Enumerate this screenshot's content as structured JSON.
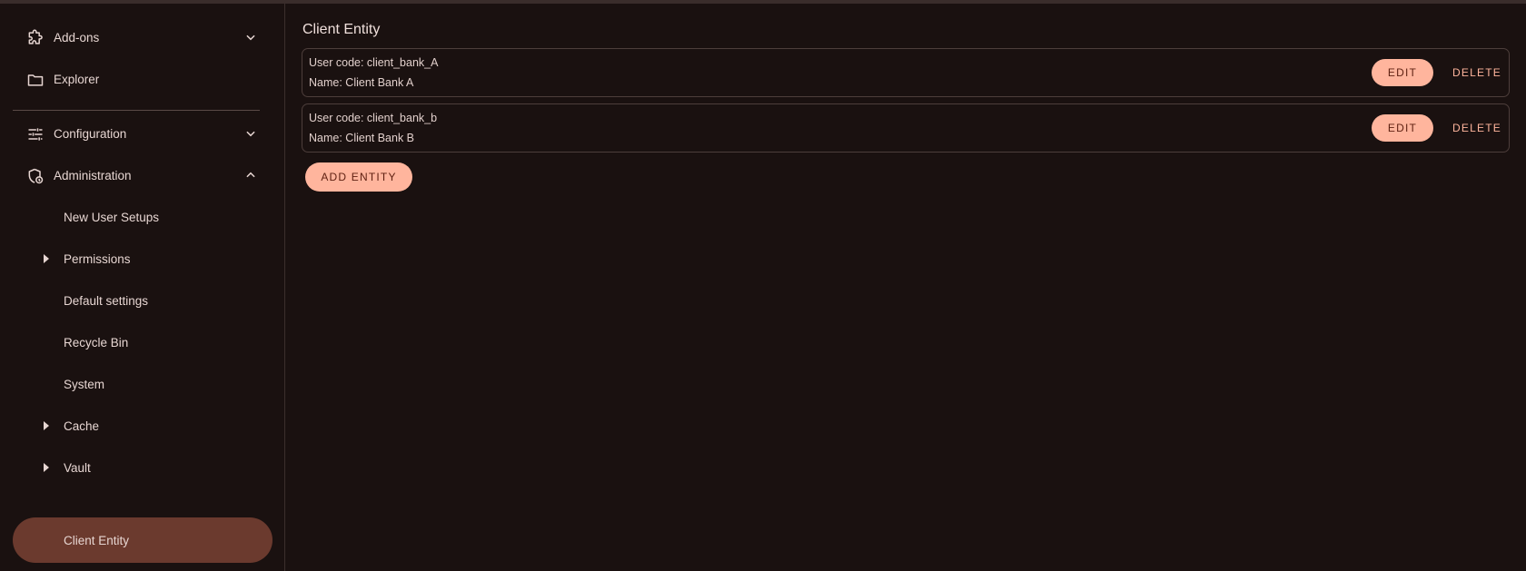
{
  "sidebar": {
    "items": [
      {
        "label": "Add-ons",
        "icon": "puzzle-icon",
        "chevron": "down"
      },
      {
        "label": "Explorer",
        "icon": "folder-icon"
      },
      {
        "label": "Configuration",
        "icon": "tune-icon",
        "chevron": "down"
      },
      {
        "label": "Administration",
        "icon": "admin-shield-icon",
        "chevron": "up"
      }
    ],
    "admin_children": [
      {
        "label": "New User Setups",
        "expandable": false
      },
      {
        "label": "Permissions",
        "expandable": true
      },
      {
        "label": "Default settings",
        "expandable": false
      },
      {
        "label": "Recycle Bin",
        "expandable": false
      },
      {
        "label": "System",
        "expandable": false
      },
      {
        "label": "Cache",
        "expandable": true
      },
      {
        "label": "Vault",
        "expandable": true
      },
      {
        "label": "Client Entity",
        "expandable": false,
        "active": true
      }
    ]
  },
  "main": {
    "title": "Client Entity",
    "entities": [
      {
        "code_line": "User code: client_bank_A",
        "name_line": "Name: Client Bank A"
      },
      {
        "code_line": "User code: client_bank_b",
        "name_line": "Name: Client Bank B"
      }
    ],
    "edit_label": "EDIT",
    "delete_label": "DELETE",
    "add_label": "ADD ENTITY"
  },
  "colors": {
    "background": "#1a1110",
    "accent": "#ffb59d",
    "active_nav": "#6b3a2e",
    "text": "#f0dfdb"
  }
}
